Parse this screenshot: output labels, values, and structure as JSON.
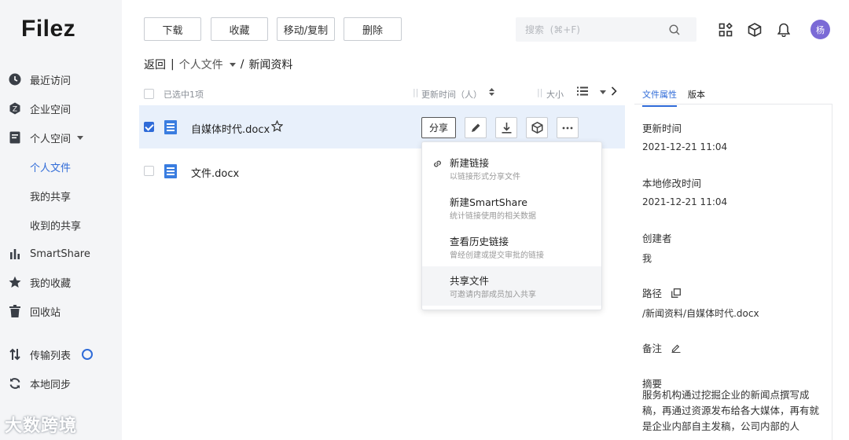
{
  "app": {
    "logo": "Filez"
  },
  "sidebar": {
    "items": [
      {
        "label": "最近访问",
        "icon": "clock-icon"
      },
      {
        "label": "企业空间",
        "icon": "enterprise-icon"
      },
      {
        "label": "个人空间",
        "icon": "personal-space-icon"
      },
      {
        "label": "个人文件",
        "icon": "",
        "active": true
      },
      {
        "label": "我的共享",
        "icon": ""
      },
      {
        "label": "收到的共享",
        "icon": ""
      },
      {
        "label": "SmartShare",
        "icon": "bar-chart-icon"
      },
      {
        "label": "我的收藏",
        "icon": "star-icon"
      },
      {
        "label": "回收站",
        "icon": "trash-icon"
      },
      {
        "label": "传输列表",
        "icon": "transfer-icon"
      },
      {
        "label": "本地同步",
        "icon": "sync-icon"
      }
    ]
  },
  "watermark": "大数跨境",
  "toolbar": {
    "download": "下载",
    "favorite": "收藏",
    "move_copy": "移动/复制",
    "delete": "删除"
  },
  "search": {
    "placeholder": "搜索  (⌘+F)"
  },
  "user": {
    "avatar_text": "杨"
  },
  "breadcrumb": {
    "back": "返回",
    "separator": "|",
    "parent": "个人文件",
    "slash": "/",
    "current": "新闻资料"
  },
  "list": {
    "selected_count": "已选中1项",
    "col_updated": "更新时间（人）",
    "col_size": "大小",
    "rows": [
      {
        "name": "自媒体时代.docx",
        "selected": true
      },
      {
        "name": "文件.docx",
        "selected": false
      }
    ],
    "share_label": "分享"
  },
  "share_menu": [
    {
      "title": "新建链接",
      "desc": "以链接形式分享文件"
    },
    {
      "title": "新建SmartShare",
      "desc": "统计链接使用的相关数据"
    },
    {
      "title": "查看历史链接",
      "desc": "曾经创建或提交审批的链接"
    },
    {
      "title": "共享文件",
      "desc": "可邀请内部成员加入共享"
    }
  ],
  "panel": {
    "tabs": [
      "文件属性",
      "版本"
    ],
    "updated_label": "更新时间",
    "updated_value": "2021-12-21 11:04",
    "local_modified_label": "本地修改时间",
    "local_modified_value": "2021-12-21 11:04",
    "creator_label": "创建者",
    "creator_value": "我",
    "path_label": "路径",
    "path_value": "/新闻资料/自媒体时代.docx",
    "note_label": "备注",
    "summary_label": "摘要",
    "summary_text": "服务机构通过挖掘企业的新闻点撰写成稿，再通过资源发布给各大媒体，再有就是企业内部自主发稿，公司内部的人"
  }
}
